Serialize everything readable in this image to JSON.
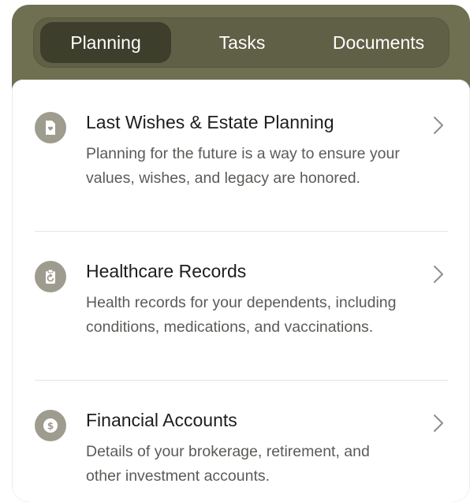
{
  "tabs": [
    {
      "label": "Planning",
      "active": true
    },
    {
      "label": "Tasks",
      "active": false
    },
    {
      "label": "Documents",
      "active": false
    }
  ],
  "items": [
    {
      "title": "Last Wishes & Estate Planning",
      "description": "Planning for the future is a way to ensure your values, wishes, and legacy are honored.",
      "icon": "document-heart-icon"
    },
    {
      "title": "Healthcare Records",
      "description": "Health records for your dependents, including conditions, medications, and vaccinations.",
      "icon": "clipboard-refresh-icon"
    },
    {
      "title": "Financial Accounts",
      "description": "Details of your brokerage, retirement, and other investment accounts.",
      "icon": "dollar-coin-icon"
    }
  ],
  "colors": {
    "frame": "#6f7052",
    "tab_active": "#3d3e2c",
    "icon_bg": "#9e9c8e"
  }
}
